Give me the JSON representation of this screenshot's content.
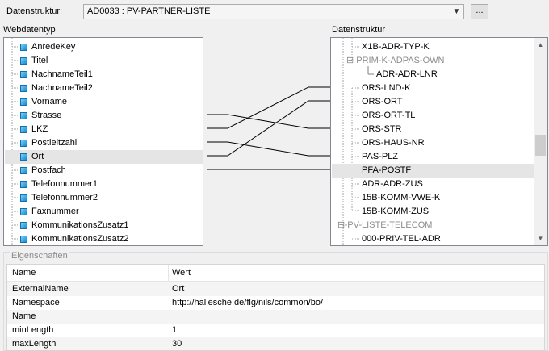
{
  "header": {
    "datenstruktur_label": "Datenstruktur:",
    "combo_value": "AD0033 : PV-PARTNER-LISTE",
    "browse_button": "..."
  },
  "left_panel": {
    "title": "Webdatentyp",
    "items": [
      {
        "label": "AnredeKey"
      },
      {
        "label": "Titel"
      },
      {
        "label": "NachnameTeil1"
      },
      {
        "label": "NachnameTeil2"
      },
      {
        "label": "Vorname"
      },
      {
        "label": "Strasse"
      },
      {
        "label": "LKZ"
      },
      {
        "label": "Postleitzahl"
      },
      {
        "label": "Ort"
      },
      {
        "label": "Postfach"
      },
      {
        "label": "Telefonnummer1"
      },
      {
        "label": "Telefonnummer2"
      },
      {
        "label": "Faxnummer"
      },
      {
        "label": "KommunikationsZusatz1"
      },
      {
        "label": "KommunikationsZusatz2"
      }
    ]
  },
  "right_panel": {
    "title": "Datenstruktur",
    "items": [
      {
        "label": "X1B-ADR-TYP-K"
      },
      {
        "label": "PRIM-K-ADPAS-OWN",
        "collapse_glyph": "⊟"
      },
      {
        "label": "ADR-ADR-LNR"
      },
      {
        "label": "ORS-LND-K"
      },
      {
        "label": "ORS-ORT"
      },
      {
        "label": "ORS-ORT-TL"
      },
      {
        "label": "ORS-STR"
      },
      {
        "label": "ORS-HAUS-NR"
      },
      {
        "label": "PAS-PLZ"
      },
      {
        "label": "PFA-POSTF"
      },
      {
        "label": "ADR-ADR-ZUS"
      },
      {
        "label": "15B-KOMM-VWE-K"
      },
      {
        "label": "15B-KOMM-ZUS"
      },
      {
        "label": "PV-LISTE-TELECOM",
        "collapse_glyph": "⊟"
      },
      {
        "label": "000-PRIV-TEL-ADR"
      }
    ]
  },
  "mappings_note": "Strasse→ORS-STR, LKZ→ORS-LND-K, Postleitzahl→PAS-PLZ, Ort→ORS-ORT, Postfach→PFA-POSTF",
  "properties": {
    "legend": "Eigenschaften",
    "columns": {
      "name": "Name",
      "value": "Wert"
    },
    "rows": [
      {
        "name": "ExternalName",
        "value": "Ort"
      },
      {
        "name": "Namespace",
        "value": "http://hallesche.de/flg/nils/common/bo/"
      },
      {
        "name": "Name",
        "value": ""
      },
      {
        "name": "minLength",
        "value": "1"
      },
      {
        "name": "maxLength",
        "value": "30"
      }
    ]
  },
  "icons": {
    "combo_arrow": "chevron-down-icon",
    "scroll_up": "scroll-up-icon",
    "scroll_down": "scroll-down-icon",
    "field_node": "field-node-icon"
  },
  "colors": {
    "selection": "#e5e5e5",
    "node_icon": "#1b87c9",
    "collapsed_gray": "#8c8c8c"
  }
}
